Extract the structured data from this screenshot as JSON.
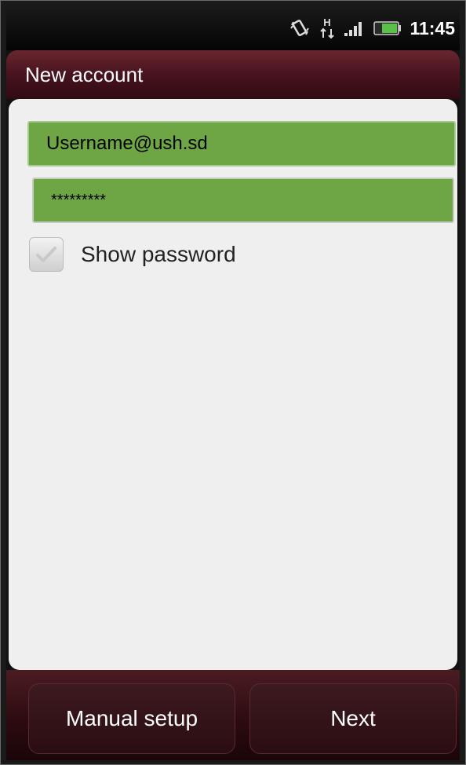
{
  "status_bar": {
    "time": "11:45",
    "network_type": "H",
    "icons": [
      "vibrate-icon",
      "hspa-icon",
      "signal-icon",
      "battery-icon"
    ]
  },
  "header": {
    "title": "New account"
  },
  "form": {
    "email_value": "Username@ush.sd",
    "password_value": "*********",
    "show_password_label": "Show password",
    "show_password_checked": false
  },
  "footer": {
    "manual_setup_label": "Manual setup",
    "next_label": "Next"
  },
  "colors": {
    "title_bar": "#4a1520",
    "field_fill": "#6ea646",
    "content_bg": "#efefef"
  }
}
